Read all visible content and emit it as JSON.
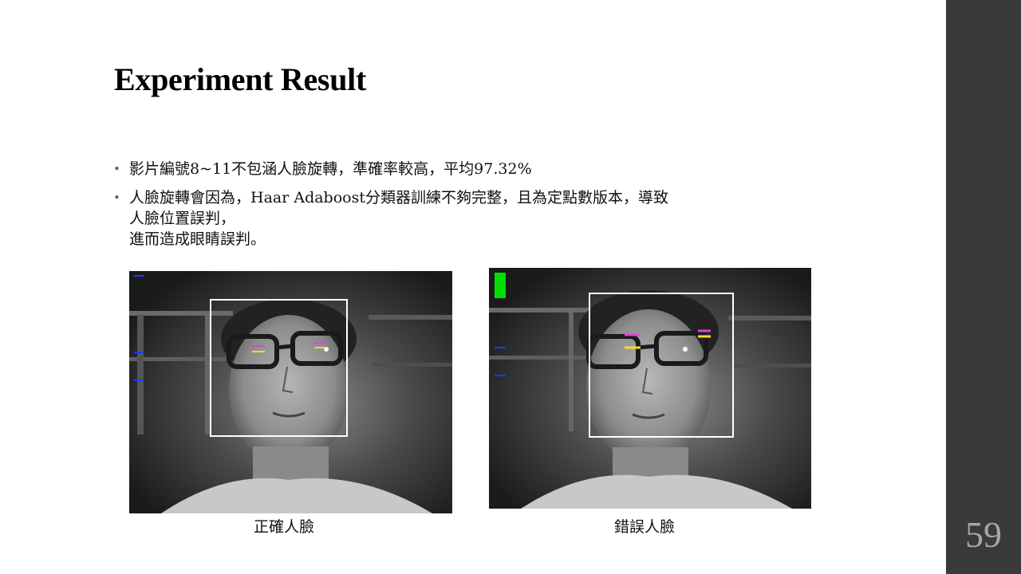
{
  "slide": {
    "title": "Experiment Result",
    "page_number": "59"
  },
  "bullets": [
    {
      "lines": [
        "影片編號8~11不包涵人臉旋轉，準確率較高，平均97.32%"
      ]
    },
    {
      "lines": [
        "人臉旋轉會因為，Haar Adaboost分類器訓練不夠完整，且為定點數版本，導致",
        "人臉位置誤判，",
        "進而造成眼睛誤判。"
      ]
    }
  ],
  "figures": {
    "left_caption": "正確人臉",
    "right_caption": "錯誤人臉"
  },
  "colors": {
    "side_panel": "#3a3a3c",
    "face_box": "#ffffff",
    "eye_marker_magenta": "#e040e0",
    "eye_marker_yellow": "#f0e020",
    "indicator_green": "#00e000",
    "indicator_blue": "#1a3cff"
  }
}
